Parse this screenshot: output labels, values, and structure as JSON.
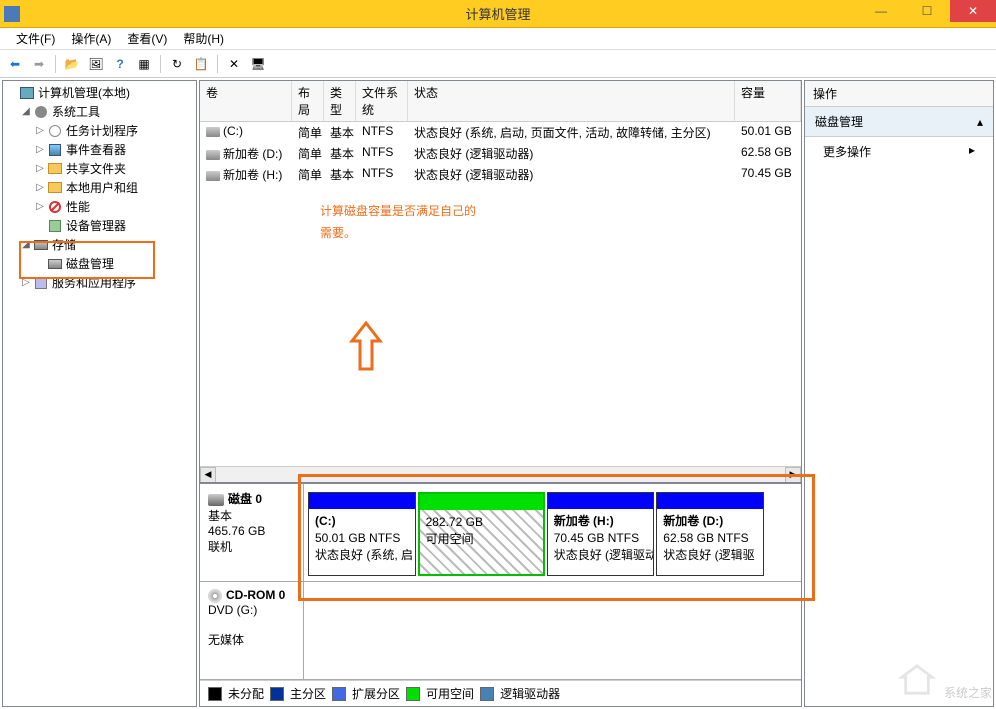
{
  "window": {
    "title": "计算机管理"
  },
  "menu": {
    "file": "文件(F)",
    "actions": "操作(A)",
    "view": "查看(V)",
    "help": "帮助(H)"
  },
  "tree": {
    "root": "计算机管理(本地)",
    "system_tools": "系统工具",
    "task_scheduler": "任务计划程序",
    "event_viewer": "事件查看器",
    "shared_folders": "共享文件夹",
    "local_users": "本地用户和组",
    "performance": "性能",
    "device_manager": "设备管理器",
    "storage": "存储",
    "disk_management": "磁盘管理",
    "services_apps": "服务和应用程序"
  },
  "vol_header": {
    "volume": "卷",
    "layout": "布局",
    "type": "类型",
    "fs": "文件系统",
    "status": "状态",
    "capacity": "容量"
  },
  "volumes": [
    {
      "name": "(C:)",
      "layout": "简单",
      "type": "基本",
      "fs": "NTFS",
      "status": "状态良好 (系统, 启动, 页面文件, 活动, 故障转储, 主分区)",
      "capacity": "50.01 GB"
    },
    {
      "name": "新加卷 (D:)",
      "layout": "简单",
      "type": "基本",
      "fs": "NTFS",
      "status": "状态良好 (逻辑驱动器)",
      "capacity": "62.58 GB"
    },
    {
      "name": "新加卷 (H:)",
      "layout": "简单",
      "type": "基本",
      "fs": "NTFS",
      "status": "状态良好 (逻辑驱动器)",
      "capacity": "70.45 GB"
    }
  ],
  "annotation": {
    "line1": "计算磁盘容量是否满足自己的",
    "line2": "需要。"
  },
  "disk0": {
    "title": "磁盘 0",
    "type": "基本",
    "size": "465.76 GB",
    "status": "联机",
    "parts": [
      {
        "name": "(C:)",
        "size": "50.01 GB NTFS",
        "status": "状态良好 (系统, 启"
      },
      {
        "name": "",
        "size": "282.72 GB",
        "status": "可用空间"
      },
      {
        "name": "新加卷 (H:)",
        "size": "70.45 GB NTFS",
        "status": "状态良好 (逻辑驱动"
      },
      {
        "name": "新加卷 (D:)",
        "size": "62.58 GB NTFS",
        "status": "状态良好 (逻辑驱"
      }
    ]
  },
  "cdrom": {
    "title": "CD-ROM 0",
    "drive": "DVD (G:)",
    "status": "无媒体"
  },
  "legend": {
    "unallocated": "未分配",
    "primary": "主分区",
    "extended": "扩展分区",
    "free": "可用空间",
    "logical": "逻辑驱动器"
  },
  "actions": {
    "header": "操作",
    "section": "磁盘管理",
    "more": "更多操作"
  },
  "watermark": "系统之家"
}
